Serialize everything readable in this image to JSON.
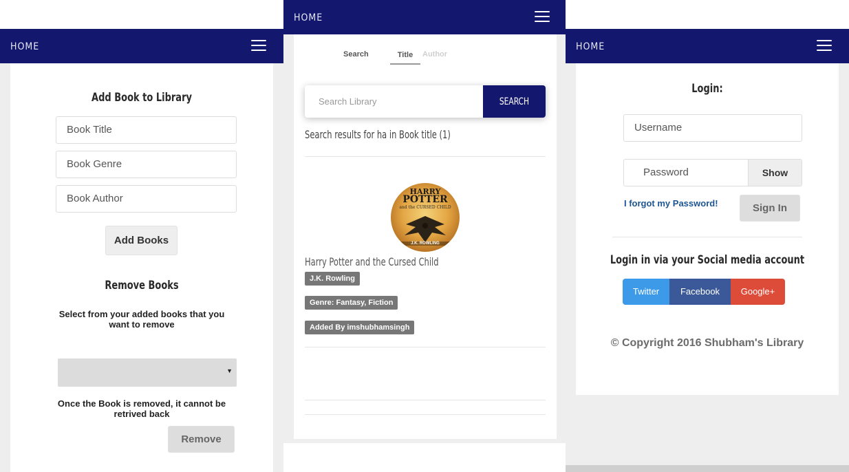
{
  "left": {
    "nav": {
      "home": "HOME"
    },
    "add_section": {
      "heading": "Add Book to Library",
      "fields": [
        {
          "placeholder": "Book Title"
        },
        {
          "placeholder": "Book Genre"
        },
        {
          "placeholder": "Book Author"
        }
      ],
      "add_button": "Add Books"
    },
    "remove_section": {
      "heading": "Remove Books",
      "instruction": "Select from your added books that you want to remove",
      "select_value": "",
      "warning": "Once the Book is removed, it cannot be retrived back",
      "remove_button": "Remove"
    }
  },
  "center": {
    "nav": {
      "home": "HOME"
    },
    "search_tabs": {
      "label": "Search",
      "tabs": [
        "Title",
        "Author"
      ],
      "active_tab": "Title"
    },
    "search": {
      "placeholder": "Search Library",
      "button": "SEARCH"
    },
    "results_text": "Search results for ha in Book title (1)",
    "result": {
      "cover_top": "HARRY",
      "cover_mid": "POTTER",
      "cover_sub": "and the CURSED CHILD",
      "cover_author": "J.K. ROWLING",
      "title": "Harry Potter and the Cursed Child",
      "author": "J.K. Rowling",
      "genre": "Genre: Fantasy, Fiction",
      "added_by": "Added By imshubhamsingh"
    }
  },
  "right": {
    "nav": {
      "home": "HOME"
    },
    "login": {
      "heading": "Login:",
      "username_placeholder": "Username",
      "password_placeholder": "Password",
      "show_button": "Show",
      "forgot": "I forgot my Password!",
      "sign_in": "Sign In"
    },
    "social": {
      "heading": "Login in via your Social media account",
      "twitter": "Twitter",
      "facebook": "Facebook",
      "google": "Google+"
    },
    "copyright": "© Copyright 2016 Shubham's Library"
  },
  "colors": {
    "navbar": "#13186e",
    "twitter": "#3d9ae8",
    "facebook": "#3b5998",
    "google": "#dd4b39",
    "badge": "#777777",
    "link": "#1c5591"
  }
}
